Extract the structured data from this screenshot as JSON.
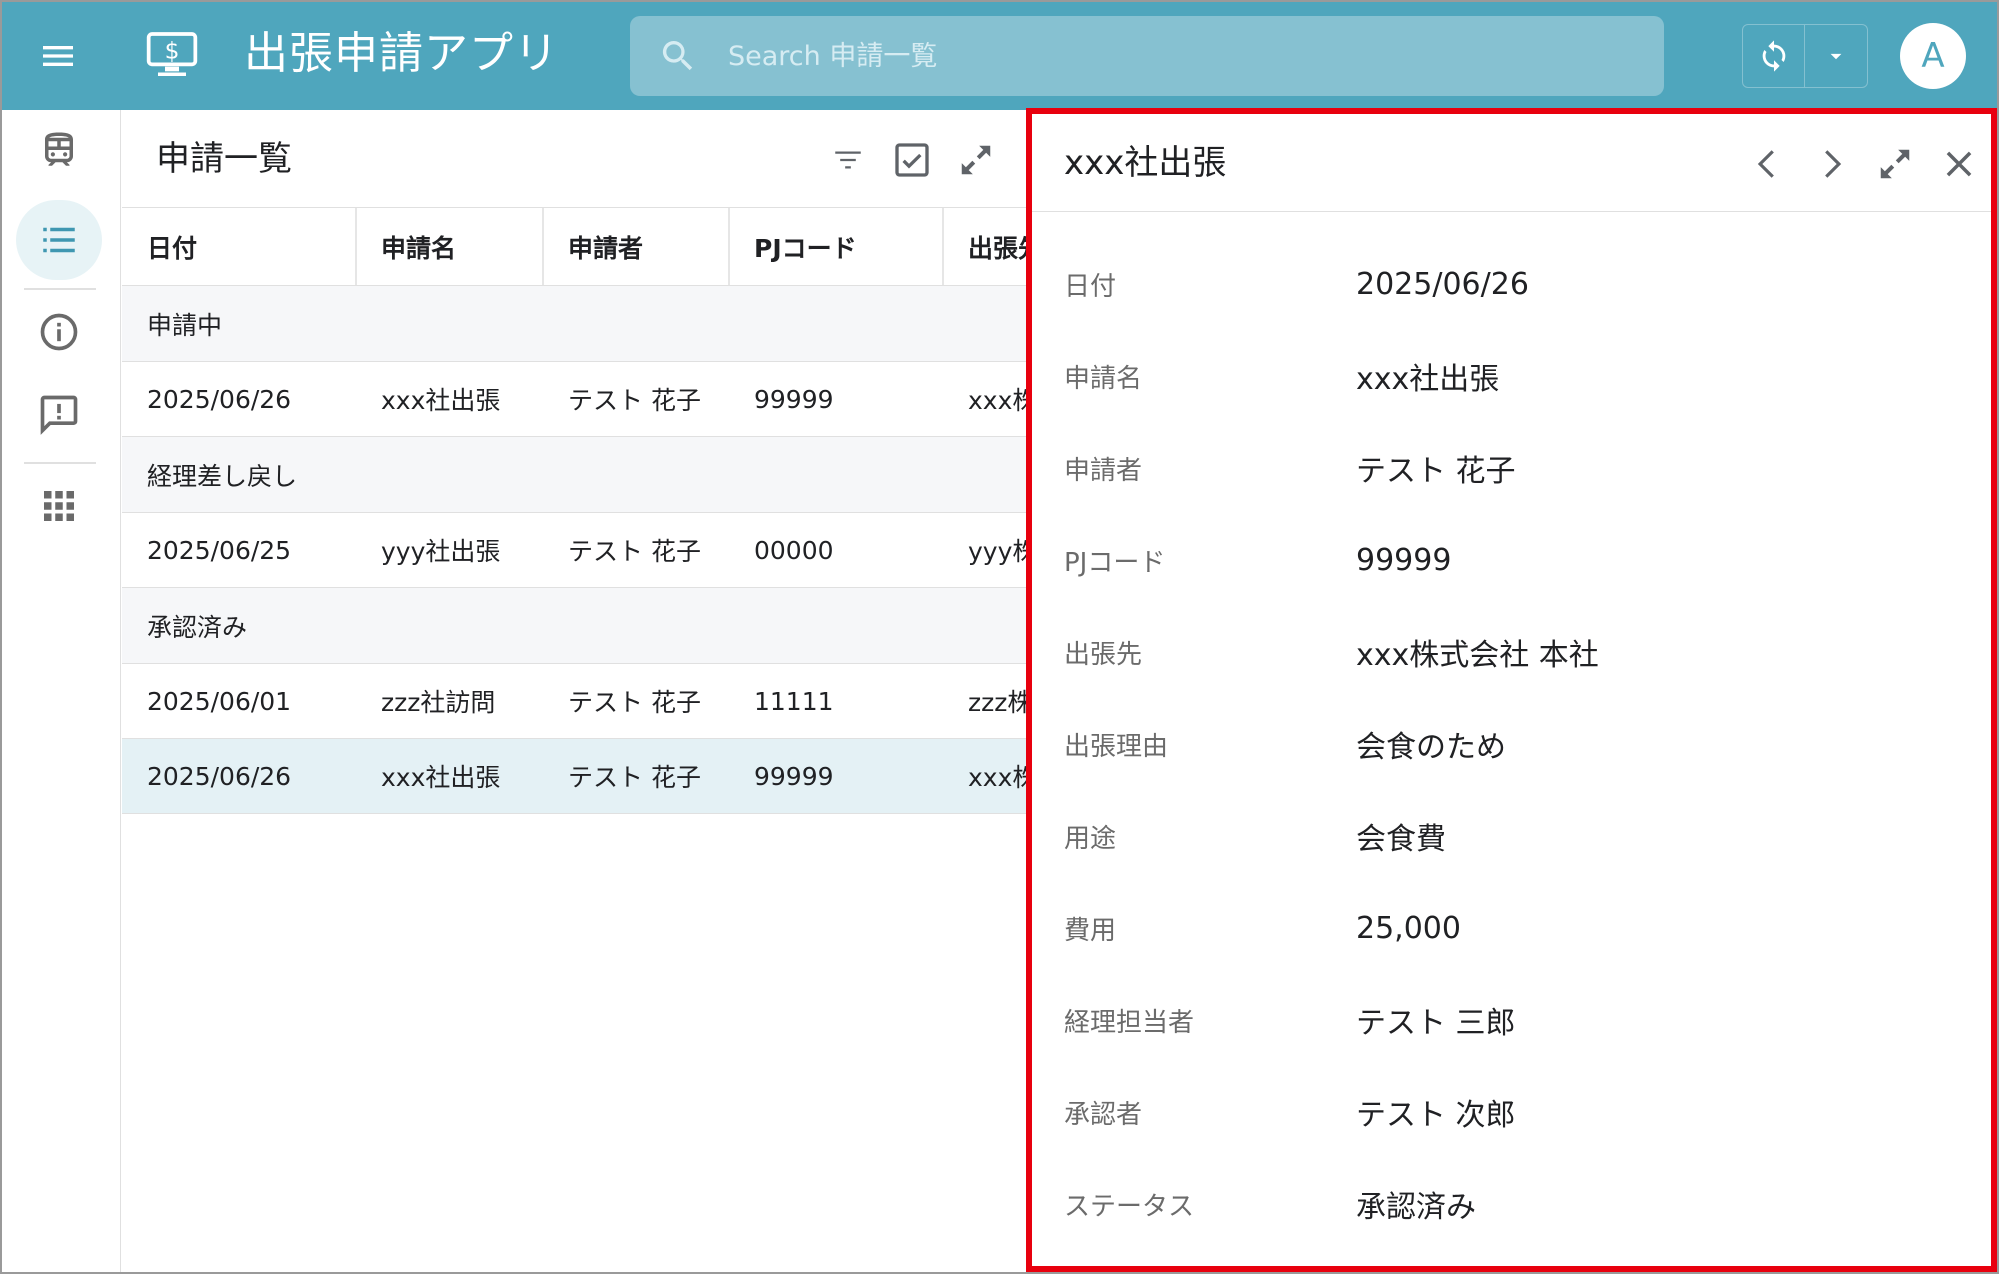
{
  "app": {
    "title": "出張申請アプリ",
    "search_placeholder": "Search 申請一覧",
    "avatar_letter": "A",
    "accent_color": "#4fa6bd",
    "highlight_color": "#e8000e"
  },
  "rail": {
    "items": [
      {
        "icon": "train-icon"
      },
      {
        "icon": "list-icon",
        "active": true
      },
      {
        "icon": "info-icon"
      },
      {
        "icon": "feedback-icon"
      },
      {
        "icon": "apps-grid-icon"
      }
    ]
  },
  "list": {
    "title": "申請一覧",
    "columns": [
      "日付",
      "申請名",
      "申請者",
      "PJコード",
      "出張先"
    ],
    "groups": [
      {
        "label": "申請中",
        "rows": [
          {
            "date": "2025/06/26",
            "name": "xxx社出張",
            "applicant": "テスト 花子",
            "pj": "99999",
            "dest": "xxx株式会社 本社"
          }
        ]
      },
      {
        "label": "経理差し戻し",
        "rows": [
          {
            "date": "2025/06/25",
            "name": "yyy社出張",
            "applicant": "テスト 花子",
            "pj": "00000",
            "dest": "yyy株式会社"
          }
        ]
      },
      {
        "label": "承認済み",
        "rows": [
          {
            "date": "2025/06/01",
            "name": "zzz社訪問",
            "applicant": "テスト 花子",
            "pj": "11111",
            "dest": "zzz株式会社"
          },
          {
            "date": "2025/06/26",
            "name": "xxx社出張",
            "applicant": "テスト 花子",
            "pj": "99999",
            "dest": "xxx株式会社 本社",
            "selected": true
          }
        ]
      }
    ]
  },
  "detail": {
    "title": "xxx社出張",
    "fields": [
      {
        "label": "日付",
        "value": "2025/06/26"
      },
      {
        "label": "申請名",
        "value": "xxx社出張"
      },
      {
        "label": "申請者",
        "value": "テスト 花子"
      },
      {
        "label": "PJコード",
        "value": "99999"
      },
      {
        "label": "出張先",
        "value": "xxx株式会社 本社"
      },
      {
        "label": "出張理由",
        "value": "会食のため"
      },
      {
        "label": "用途",
        "value": "会食費"
      },
      {
        "label": "費用",
        "value": "25,000"
      },
      {
        "label": "経理担当者",
        "value": "テスト 三郎"
      },
      {
        "label": "承認者",
        "value": "テスト 次郎"
      },
      {
        "label": "ステータス",
        "value": "承認済み"
      }
    ]
  }
}
